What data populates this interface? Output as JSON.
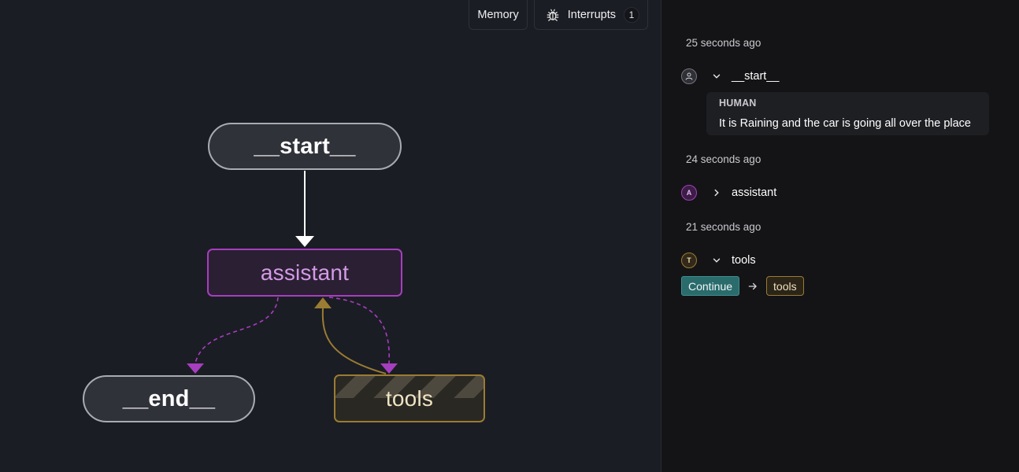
{
  "toolbar": {
    "memory_label": "Memory",
    "interrupts_label": "Interrupts",
    "interrupts_count": "1"
  },
  "graph": {
    "nodes": {
      "start": "__start__",
      "assistant": "assistant",
      "end": "__end__",
      "tools": "tools"
    },
    "colors": {
      "assistant_accent": "#a63ec0",
      "tools_accent": "#9a7c32",
      "edge_default": "#ffffff"
    }
  },
  "panel": {
    "groups": [
      {
        "time": "25 seconds ago",
        "node": "__start__",
        "icon": "user-icon",
        "expanded": true,
        "message": {
          "role": "HUMAN",
          "text": "It is Raining and the car is going all over the place"
        }
      },
      {
        "time": "24 seconds ago",
        "node": "assistant",
        "badge": "A",
        "expanded": false
      },
      {
        "time": "21 seconds ago",
        "node": "tools",
        "badge": "T",
        "expanded": true,
        "command": {
          "action": "Continue",
          "target": "tools"
        }
      }
    ]
  }
}
